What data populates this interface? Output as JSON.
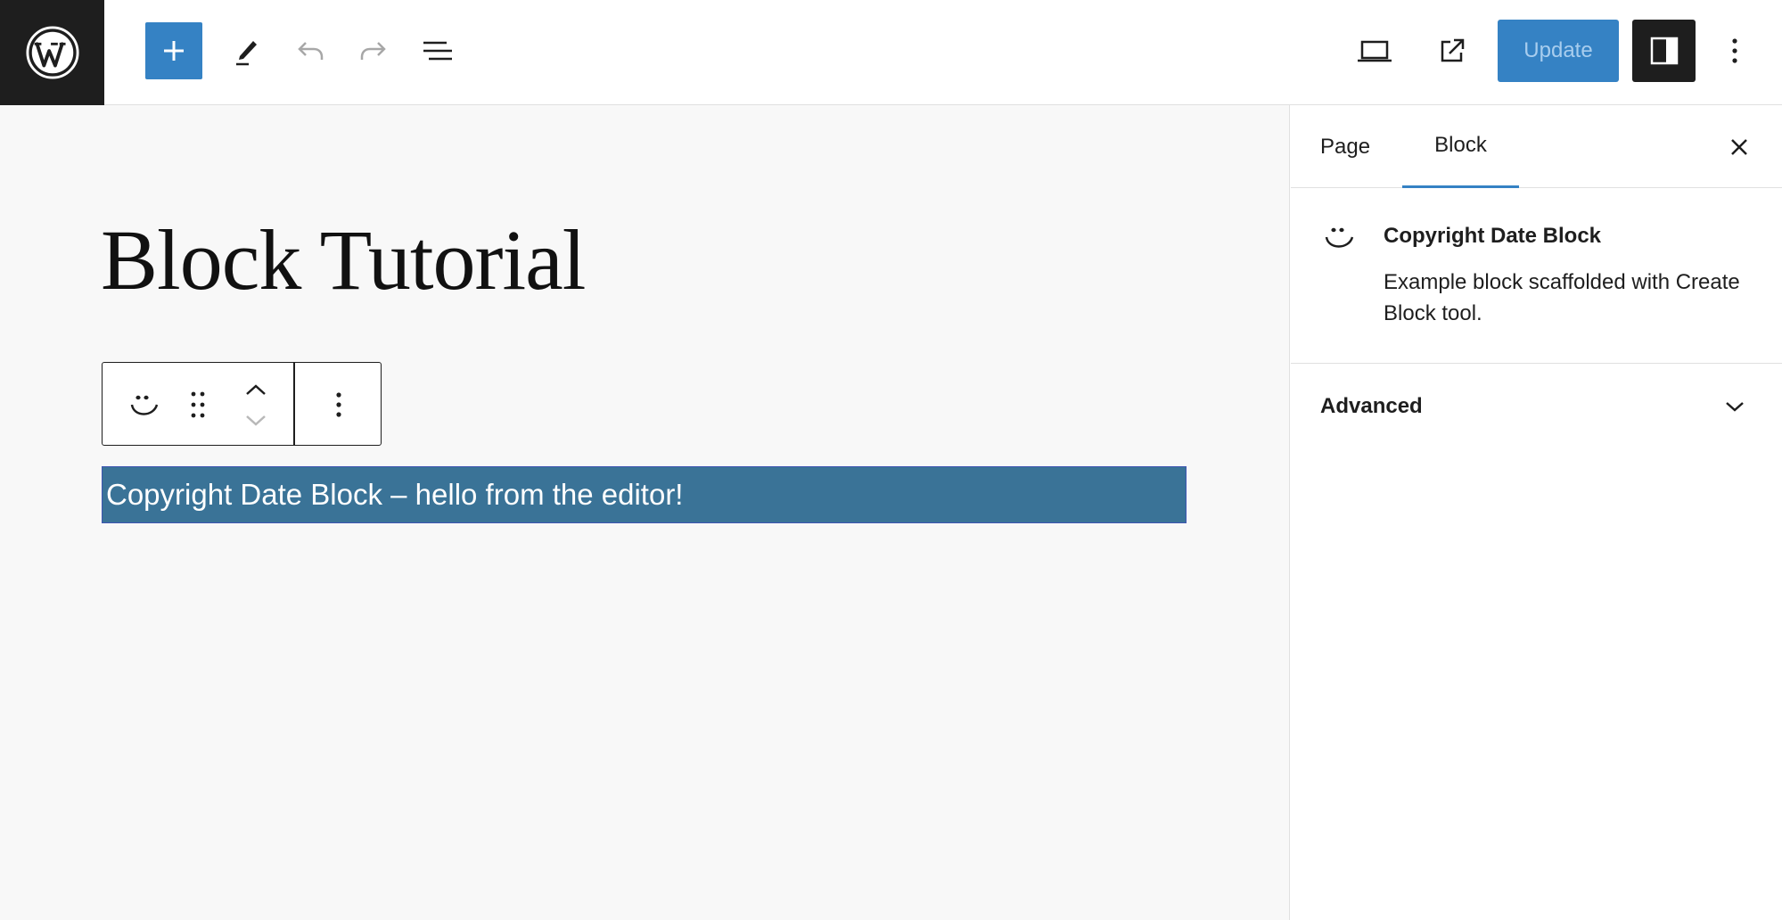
{
  "topbar": {
    "logo_icon": "wordpress-logo-icon",
    "add_block_icon": "plus-icon",
    "tools_icon": "pencil-icon",
    "undo_icon": "undo-icon",
    "redo_icon": "redo-icon",
    "list_view_icon": "list-view-icon",
    "preview_icon": "laptop-icon",
    "view_page_icon": "external-link-icon",
    "update_label": "Update",
    "settings_icon": "sidebar-toggle-icon",
    "options_icon": "more-vertical-icon"
  },
  "canvas": {
    "page_title": "Block Tutorial",
    "block_toolbar": {
      "block_type_icon": "smiley-icon",
      "drag_icon": "drag-handle-icon",
      "move_up_icon": "chevron-up-icon",
      "move_down_icon": "chevron-down-icon",
      "options_icon": "more-vertical-icon"
    },
    "selected_block_text": "Copyright Date Block – hello from the editor!"
  },
  "sidebar": {
    "tabs": [
      {
        "label": "Page",
        "active": false
      },
      {
        "label": "Block",
        "active": true
      }
    ],
    "close_icon": "close-icon",
    "block_card": {
      "icon": "smiley-icon",
      "title": "Copyright Date Block",
      "description": "Example block scaffolded with Create Block tool."
    },
    "advanced": {
      "label": "Advanced",
      "icon": "chevron-down-icon"
    }
  },
  "colors": {
    "accent": "#3582c4",
    "dark": "#1e1e1e",
    "selection": "#3a7397",
    "canvas_bg": "#f8f8f8"
  }
}
